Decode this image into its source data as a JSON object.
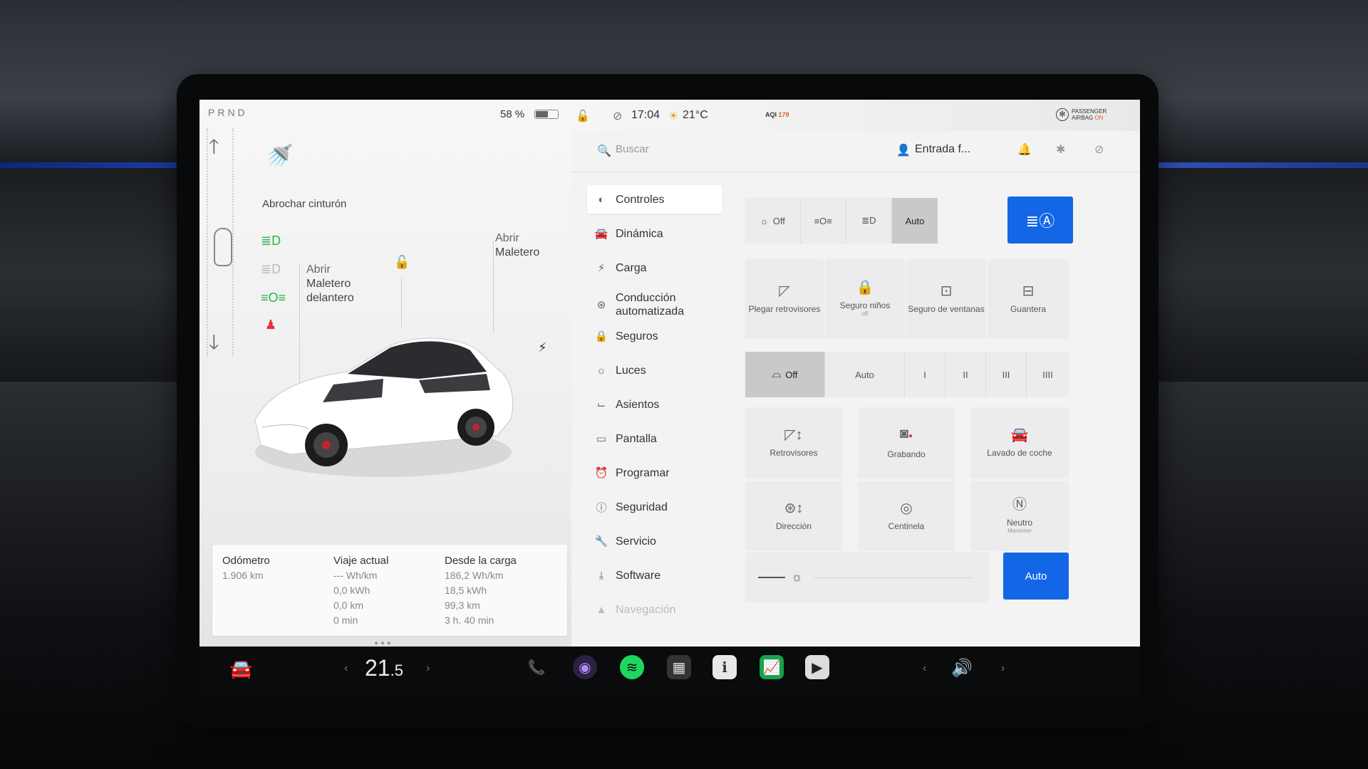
{
  "left_panel": {
    "gear": "PRND",
    "battery_percent_text": "58 %",
    "battery_level": 0.58,
    "seatbelt_alert": "Abrochar cinturón",
    "open_trunk": [
      "Abrir",
      "Maletero"
    ],
    "open_frunk": [
      "Abrir",
      "Maletero",
      "delantero"
    ],
    "trip": {
      "odometer": {
        "label": "Odómetro",
        "value": "1.906 km"
      },
      "current_trip": {
        "label": "Viaje actual",
        "lines": [
          "--- Wh/km",
          "0,0 kWh",
          "0,0 km",
          "0 min"
        ]
      },
      "since_charge": {
        "label": "Desde la carga",
        "lines": [
          "186,2 Wh/km",
          "18,5 kWh",
          "99,3 km",
          "3 h. 40 min"
        ]
      }
    }
  },
  "status_bar": {
    "time": "17:04",
    "temperature": "21°C",
    "aqi_label": "AQI",
    "aqi_value": "179",
    "airbag": [
      "PASSENGER",
      "AIRBAG"
    ],
    "airbag_state": "ON"
  },
  "top_bar": {
    "search_placeholder": "Buscar",
    "profile": "Entrada f..."
  },
  "menu": [
    {
      "label": "Controles",
      "icon": "toggle-icon",
      "glyph": "◐"
    },
    {
      "label": "Dinámica",
      "icon": "car-icon",
      "glyph": "🚘"
    },
    {
      "label": "Carga",
      "icon": "bolt-icon",
      "glyph": "⚡"
    },
    {
      "label": "Conducción\nautomatizada",
      "icon": "steering-wheel-icon",
      "glyph": "⊛"
    },
    {
      "label": "Seguros",
      "icon": "lock-icon",
      "glyph": "🔒"
    },
    {
      "label": "Luces",
      "icon": "light-icon",
      "glyph": "☼"
    },
    {
      "label": "Asientos",
      "icon": "seat-icon",
      "glyph": "⌙"
    },
    {
      "label": "Pantalla",
      "icon": "display-icon",
      "glyph": "▭"
    },
    {
      "label": "Programar",
      "icon": "clock-icon",
      "glyph": "⏰"
    },
    {
      "label": "Seguridad",
      "icon": "info-icon",
      "glyph": "ⓘ"
    },
    {
      "label": "Servicio",
      "icon": "wrench-icon",
      "glyph": "🔧"
    },
    {
      "label": "Software",
      "icon": "download-icon",
      "glyph": "⤓"
    },
    {
      "label": "Navegación",
      "icon": "navigation-icon",
      "glyph": "▲"
    }
  ],
  "controls": {
    "lights": {
      "off_label": "Off",
      "auto_label": "Auto"
    },
    "tiles_row1": [
      {
        "label": "Plegar retrovisores"
      },
      {
        "label": "Seguro niños",
        "sub": "off"
      },
      {
        "label": "Seguro de ventanas"
      },
      {
        "label": "Guantera"
      }
    ],
    "wipers": {
      "off_label": "Off",
      "auto_label": "Auto",
      "speeds": [
        "I",
        "II",
        "III",
        "IIII"
      ]
    },
    "tiles_grid": [
      {
        "label": "Retrovisores"
      },
      {
        "label": "Grabando"
      },
      {
        "label": "Lavado de coche"
      },
      {
        "label": "Dirección"
      },
      {
        "label": "Centinela"
      },
      {
        "label": "Neutro",
        "sub": "Mantener"
      }
    ],
    "brightness_auto_label": "Auto",
    "brightness_level": 0.0
  },
  "dock": {
    "temperature": "21",
    "temperature_decimal": ".5"
  },
  "colors": {
    "accent_blue": "#1366e6",
    "tell_green": "#29b34a",
    "tell_red": "#e0343c",
    "aqi_orange": "#e05a2e"
  }
}
